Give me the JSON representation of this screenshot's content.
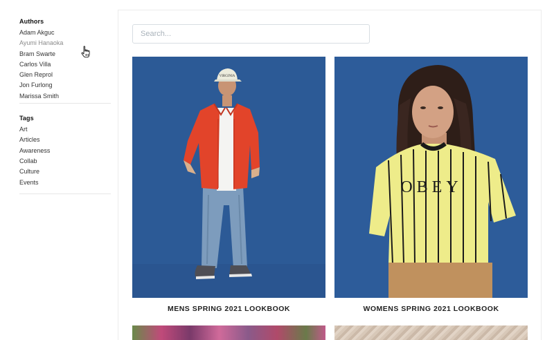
{
  "sidebar": {
    "authors_title": "Authors",
    "authors": [
      "Adam Akguc",
      "Ayumi Hanaoka",
      "Bram Swarte",
      "Carlos Villa",
      "Glen Reprol",
      "Jon Furlong",
      "Marissa Smith"
    ],
    "tags_title": "Tags",
    "tags": [
      "Art",
      "Articles",
      "Awareness",
      "Collab",
      "Culture",
      "Events"
    ]
  },
  "search": {
    "placeholder": "Search..."
  },
  "cards": [
    {
      "title": "MENS SPRING 2021 LOOKBOOK"
    },
    {
      "title": "WOMENS SPRING 2021 LOOKBOOK"
    }
  ],
  "photo_text": {
    "cap_text": "VIRGINIA",
    "shirt_text": "OBEY"
  },
  "colors": {
    "photo_background": "#2c5a96",
    "jacket": "#e2442a",
    "striped_shirt": "#eeec8a"
  }
}
